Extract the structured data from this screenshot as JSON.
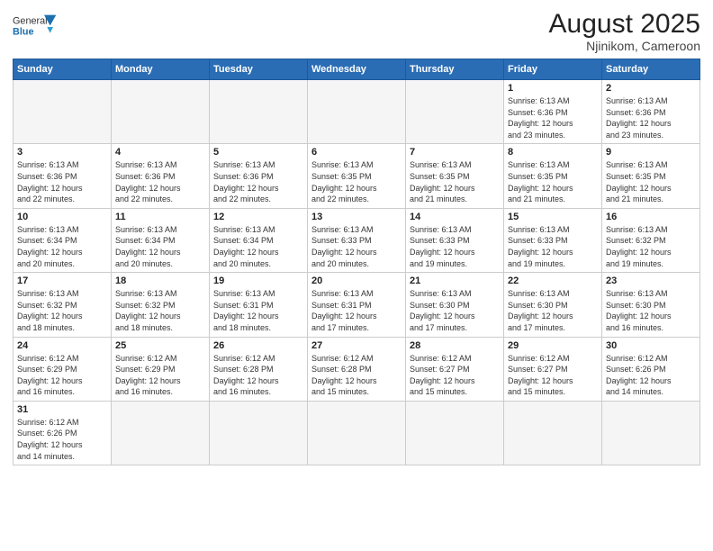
{
  "header": {
    "logo_general": "General",
    "logo_blue": "Blue",
    "title": "August 2025",
    "subtitle": "Njinikom, Cameroon"
  },
  "days_of_week": [
    "Sunday",
    "Monday",
    "Tuesday",
    "Wednesday",
    "Thursday",
    "Friday",
    "Saturday"
  ],
  "weeks": [
    [
      {
        "day": "",
        "info": ""
      },
      {
        "day": "",
        "info": ""
      },
      {
        "day": "",
        "info": ""
      },
      {
        "day": "",
        "info": ""
      },
      {
        "day": "",
        "info": ""
      },
      {
        "day": "1",
        "info": "Sunrise: 6:13 AM\nSunset: 6:36 PM\nDaylight: 12 hours\nand 23 minutes."
      },
      {
        "day": "2",
        "info": "Sunrise: 6:13 AM\nSunset: 6:36 PM\nDaylight: 12 hours\nand 23 minutes."
      }
    ],
    [
      {
        "day": "3",
        "info": "Sunrise: 6:13 AM\nSunset: 6:36 PM\nDaylight: 12 hours\nand 22 minutes."
      },
      {
        "day": "4",
        "info": "Sunrise: 6:13 AM\nSunset: 6:36 PM\nDaylight: 12 hours\nand 22 minutes."
      },
      {
        "day": "5",
        "info": "Sunrise: 6:13 AM\nSunset: 6:36 PM\nDaylight: 12 hours\nand 22 minutes."
      },
      {
        "day": "6",
        "info": "Sunrise: 6:13 AM\nSunset: 6:35 PM\nDaylight: 12 hours\nand 22 minutes."
      },
      {
        "day": "7",
        "info": "Sunrise: 6:13 AM\nSunset: 6:35 PM\nDaylight: 12 hours\nand 21 minutes."
      },
      {
        "day": "8",
        "info": "Sunrise: 6:13 AM\nSunset: 6:35 PM\nDaylight: 12 hours\nand 21 minutes."
      },
      {
        "day": "9",
        "info": "Sunrise: 6:13 AM\nSunset: 6:35 PM\nDaylight: 12 hours\nand 21 minutes."
      }
    ],
    [
      {
        "day": "10",
        "info": "Sunrise: 6:13 AM\nSunset: 6:34 PM\nDaylight: 12 hours\nand 20 minutes."
      },
      {
        "day": "11",
        "info": "Sunrise: 6:13 AM\nSunset: 6:34 PM\nDaylight: 12 hours\nand 20 minutes."
      },
      {
        "day": "12",
        "info": "Sunrise: 6:13 AM\nSunset: 6:34 PM\nDaylight: 12 hours\nand 20 minutes."
      },
      {
        "day": "13",
        "info": "Sunrise: 6:13 AM\nSunset: 6:33 PM\nDaylight: 12 hours\nand 20 minutes."
      },
      {
        "day": "14",
        "info": "Sunrise: 6:13 AM\nSunset: 6:33 PM\nDaylight: 12 hours\nand 19 minutes."
      },
      {
        "day": "15",
        "info": "Sunrise: 6:13 AM\nSunset: 6:33 PM\nDaylight: 12 hours\nand 19 minutes."
      },
      {
        "day": "16",
        "info": "Sunrise: 6:13 AM\nSunset: 6:32 PM\nDaylight: 12 hours\nand 19 minutes."
      }
    ],
    [
      {
        "day": "17",
        "info": "Sunrise: 6:13 AM\nSunset: 6:32 PM\nDaylight: 12 hours\nand 18 minutes."
      },
      {
        "day": "18",
        "info": "Sunrise: 6:13 AM\nSunset: 6:32 PM\nDaylight: 12 hours\nand 18 minutes."
      },
      {
        "day": "19",
        "info": "Sunrise: 6:13 AM\nSunset: 6:31 PM\nDaylight: 12 hours\nand 18 minutes."
      },
      {
        "day": "20",
        "info": "Sunrise: 6:13 AM\nSunset: 6:31 PM\nDaylight: 12 hours\nand 17 minutes."
      },
      {
        "day": "21",
        "info": "Sunrise: 6:13 AM\nSunset: 6:30 PM\nDaylight: 12 hours\nand 17 minutes."
      },
      {
        "day": "22",
        "info": "Sunrise: 6:13 AM\nSunset: 6:30 PM\nDaylight: 12 hours\nand 17 minutes."
      },
      {
        "day": "23",
        "info": "Sunrise: 6:13 AM\nSunset: 6:30 PM\nDaylight: 12 hours\nand 16 minutes."
      }
    ],
    [
      {
        "day": "24",
        "info": "Sunrise: 6:12 AM\nSunset: 6:29 PM\nDaylight: 12 hours\nand 16 minutes."
      },
      {
        "day": "25",
        "info": "Sunrise: 6:12 AM\nSunset: 6:29 PM\nDaylight: 12 hours\nand 16 minutes."
      },
      {
        "day": "26",
        "info": "Sunrise: 6:12 AM\nSunset: 6:28 PM\nDaylight: 12 hours\nand 16 minutes."
      },
      {
        "day": "27",
        "info": "Sunrise: 6:12 AM\nSunset: 6:28 PM\nDaylight: 12 hours\nand 15 minutes."
      },
      {
        "day": "28",
        "info": "Sunrise: 6:12 AM\nSunset: 6:27 PM\nDaylight: 12 hours\nand 15 minutes."
      },
      {
        "day": "29",
        "info": "Sunrise: 6:12 AM\nSunset: 6:27 PM\nDaylight: 12 hours\nand 15 minutes."
      },
      {
        "day": "30",
        "info": "Sunrise: 6:12 AM\nSunset: 6:26 PM\nDaylight: 12 hours\nand 14 minutes."
      }
    ],
    [
      {
        "day": "31",
        "info": "Sunrise: 6:12 AM\nSunset: 6:26 PM\nDaylight: 12 hours\nand 14 minutes."
      },
      {
        "day": "",
        "info": ""
      },
      {
        "day": "",
        "info": ""
      },
      {
        "day": "",
        "info": ""
      },
      {
        "day": "",
        "info": ""
      },
      {
        "day": "",
        "info": ""
      },
      {
        "day": "",
        "info": ""
      }
    ]
  ]
}
